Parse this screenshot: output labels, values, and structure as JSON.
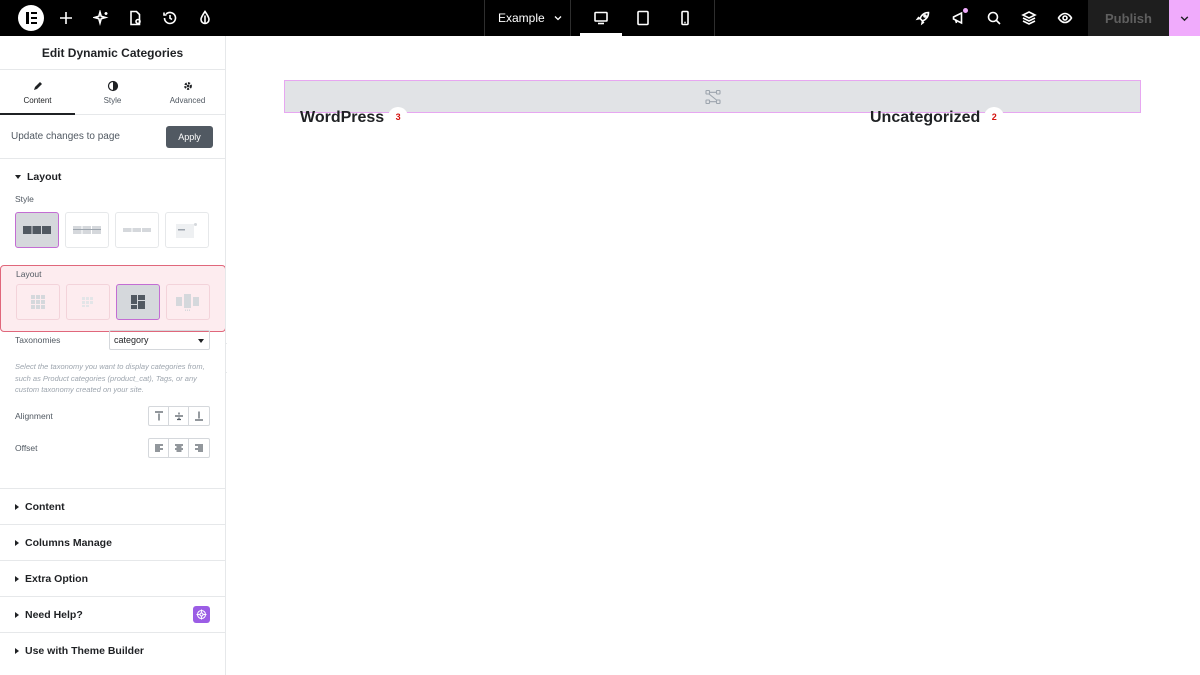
{
  "topbar": {
    "page_name": "Example",
    "publish_label": "Publish",
    "accent": "#f0abfc"
  },
  "panel": {
    "title": "Edit Dynamic Categories",
    "tabs": [
      {
        "label": "Content",
        "icon": "pencil-icon",
        "active": true
      },
      {
        "label": "Style",
        "icon": "half-circle-icon",
        "active": false
      },
      {
        "label": "Advanced",
        "icon": "gear-icon",
        "active": false
      }
    ],
    "update_text": "Update changes to page",
    "apply_label": "Apply",
    "layout_section": "Layout",
    "style_label": "Style",
    "layout_label": "Layout",
    "taxonomies_label": "Taxonomies",
    "taxonomy_value": "category",
    "help_text": "Select the taxonomy you want to display categories from, such as Product categories (product_cat), Tags, or any custom taxonomy created on your site.",
    "alignment_label": "Alignment",
    "offset_label": "Offset",
    "sections": [
      "Content",
      "Columns Manage",
      "Extra Option",
      "Need Help?",
      "Use with Theme Builder"
    ]
  },
  "canvas": {
    "categories": [
      {
        "name": "WordPress",
        "count": "3"
      },
      {
        "name": "Uncategorized",
        "count": "2"
      }
    ]
  }
}
